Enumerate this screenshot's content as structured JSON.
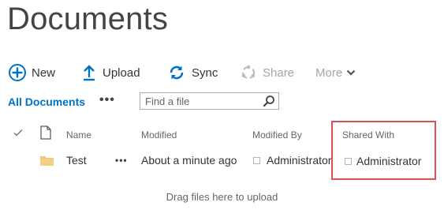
{
  "page": {
    "title": "Documents"
  },
  "commands": {
    "new_label": "New",
    "upload_label": "Upload",
    "sync_label": "Sync",
    "share_label": "Share",
    "more_label": "More"
  },
  "views": {
    "current": "All Documents",
    "more_symbol": "•••"
  },
  "search": {
    "placeholder": "Find a file"
  },
  "table": {
    "headers": {
      "name": "Name",
      "modified": "Modified",
      "modified_by": "Modified By",
      "shared_with": "Shared With"
    },
    "rows": [
      {
        "name": "Test",
        "actions": "•••",
        "modified": "About a minute ago",
        "modified_by": "Administrator",
        "shared_with": "Administrator"
      }
    ]
  },
  "upload_hint": "Drag files here to upload",
  "colors": {
    "accent": "#0072c6",
    "folder": "#f2c471",
    "highlight": "#d9534f",
    "disabled": "#a6a6a6"
  },
  "icons": [
    "plus-circle-icon",
    "upload-arrow-icon",
    "sync-icon",
    "share-icon",
    "chevron-down-icon",
    "search-icon",
    "checkmark-icon",
    "document-icon",
    "folder-icon"
  ]
}
